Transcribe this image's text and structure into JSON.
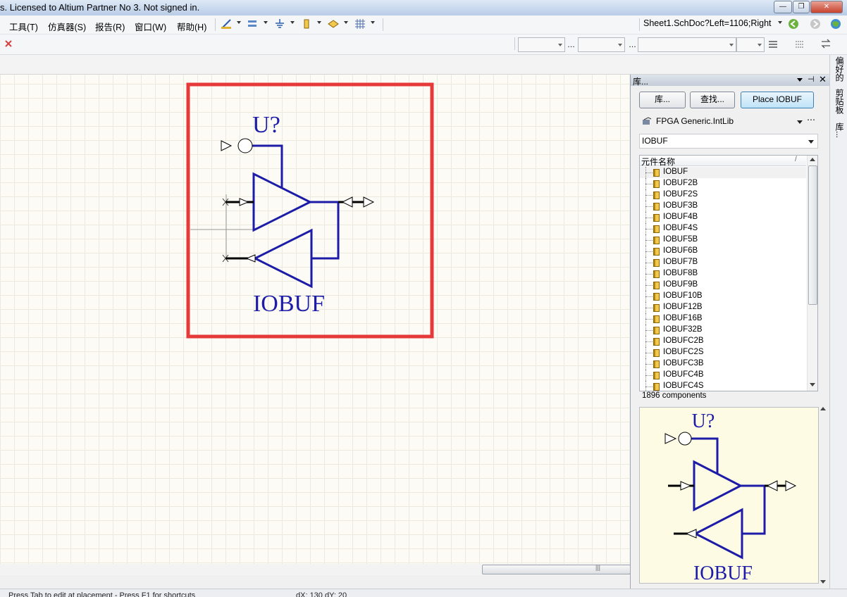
{
  "window": {
    "title": "s. Licensed to Altium Partner No 3. Not signed in.",
    "controls": [
      "minimize",
      "maximize",
      "close"
    ]
  },
  "menu": [
    "工具(T)",
    "仿真器(S)",
    "报告(R)",
    "窗口(W)",
    "帮助(H)"
  ],
  "toolbar": {
    "sheet_location": "Sheet1.SchDoc?Left=1106;Right",
    "icons": [
      "wire-icon",
      "bus-icon",
      "ground-icon",
      "part-icon",
      "port-icon",
      "grid-icon"
    ]
  },
  "schematic": {
    "designator": "U?",
    "component_name": "IOBUF",
    "highlight_color": "#e63a3a",
    "symbol_color": "#1c1ca8"
  },
  "library_panel": {
    "title": "库...",
    "buttons": {
      "libraries": "库...",
      "search": "查找...",
      "place": "Place IOBUF"
    },
    "library_name": "FPGA Generic.IntLib",
    "filter": "IOBUF",
    "column_header": "元件名称",
    "components": [
      "IOBUF",
      "IOBUF2B",
      "IOBUF2S",
      "IOBUF3B",
      "IOBUF4B",
      "IOBUF4S",
      "IOBUF5B",
      "IOBUF6B",
      "IOBUF7B",
      "IOBUF8B",
      "IOBUF9B",
      "IOBUF10B",
      "IOBUF12B",
      "IOBUF16B",
      "IOBUF32B",
      "IOBUFC2B",
      "IOBUFC2S",
      "IOBUFC3B",
      "IOBUFC4B",
      "IOBUFC4S"
    ],
    "selected": "IOBUF",
    "component_count": "1896 components",
    "preview": {
      "designator": "U?",
      "component_name": "IOBUF"
    }
  },
  "side_tabs": [
    "偏好的",
    "剪贴板",
    "库..."
  ],
  "status": {
    "hint": "Press Tab to edit at placement - Press F1 for shortcuts",
    "coords": "dX: 130 dY: 20"
  }
}
